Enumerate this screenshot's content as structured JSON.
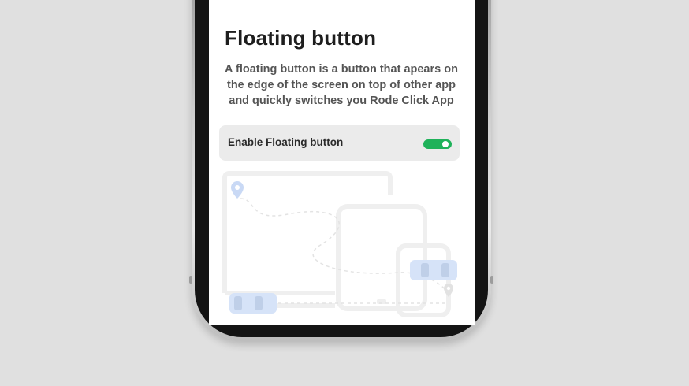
{
  "screen": {
    "title": "Floating button",
    "description": "A floating button is a button that apears on the edge of the screen on top of other app and quickly switches you Rode Click App",
    "toggle": {
      "label": "Enable Floating button",
      "enabled": true
    }
  },
  "colors": {
    "background": "#e0e0e0",
    "screen_bg": "#ffffff",
    "toggle_row_bg": "#ebebeb",
    "switch_on": "#1fb25a",
    "title_text": "#1e1e1e",
    "body_text": "#555555",
    "illustration_outline": "#eeeeee",
    "illustration_accent": "#c9d9f5"
  },
  "icons": {
    "illustration": "multi-device-floating-illustration",
    "pin": "location-pin-icon",
    "floating_pill": "floating-button-pill-icon"
  }
}
